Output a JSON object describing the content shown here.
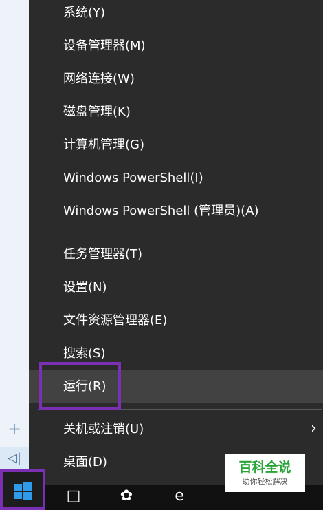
{
  "menu": {
    "items": [
      {
        "label": "系统(Y)"
      },
      {
        "label": "设备管理器(M)"
      },
      {
        "label": "网络连接(W)"
      },
      {
        "label": "磁盘管理(K)"
      },
      {
        "label": "计算机管理(G)"
      },
      {
        "label": "Windows PowerShell(I)"
      },
      {
        "label": "Windows PowerShell (管理员)(A)"
      },
      {
        "label": "任务管理器(T)"
      },
      {
        "label": "设置(N)"
      },
      {
        "label": "文件资源管理器(E)"
      },
      {
        "label": "搜索(S)"
      },
      {
        "label": "运行(R)"
      },
      {
        "label": "关机或注销(U)"
      },
      {
        "label": "桌面(D)"
      }
    ],
    "highlighted_index": 11,
    "submenu_indicator_icon": "chevron-right-icon"
  },
  "left_strip": {
    "plus_icon": "plus-icon",
    "collapse_icon": "collapse-left-icon"
  },
  "taskbar": {
    "start_icon": "windows-logo-icon",
    "icons": [
      "task-view-icon",
      "app-icon",
      "edge-icon",
      "folder-icon"
    ]
  },
  "watermark": {
    "title": "百科全说",
    "subtitle": "助你轻松解决"
  },
  "colors": {
    "menu_bg": "#2b2b2b",
    "highlight_bg": "#424242",
    "annotation": "#7b2fb3",
    "watermark_green": "#2aa53a"
  }
}
